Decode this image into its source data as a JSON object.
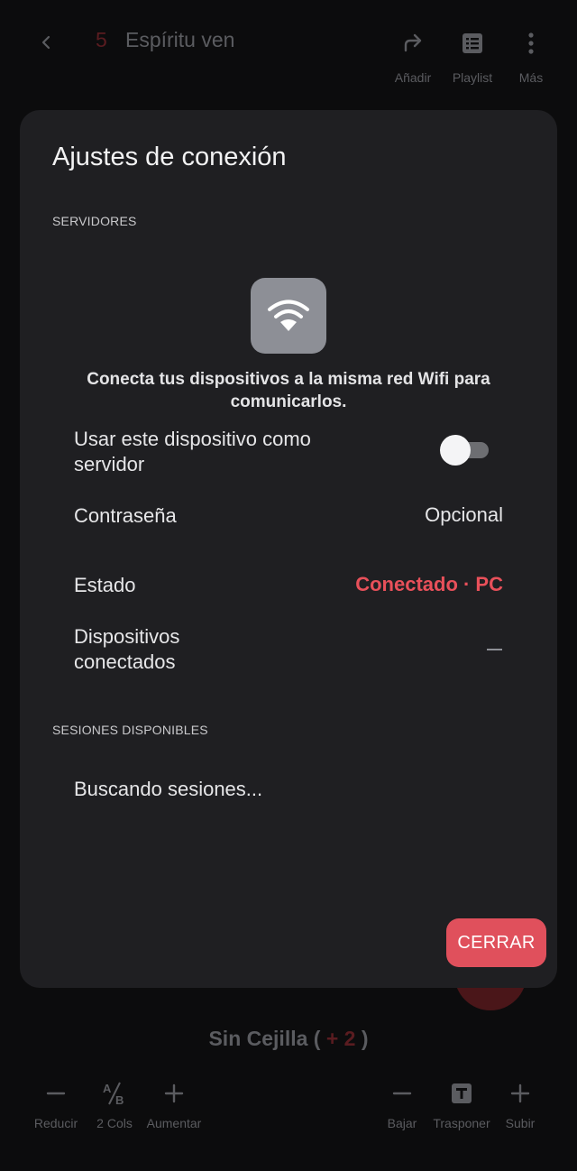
{
  "appbar": {
    "song_number": "5",
    "song_title": "Espíritu ven",
    "actions": [
      {
        "label": "Añadir",
        "icon": "share-arrow-icon"
      },
      {
        "label": "Playlist",
        "icon": "list-icon"
      },
      {
        "label": "Más",
        "icon": "more-vertical-icon"
      }
    ]
  },
  "dialog": {
    "title": "Ajustes de conexión",
    "servers_label": "SERVIDORES",
    "wifi_hint": "Conecta tus dispositivos a la misma red Wifi para comunicarlos.",
    "use_as_server_label": "Usar este dispositivo como servidor",
    "use_as_server_on": false,
    "password_label": "Contraseña",
    "password_value": "Opcional",
    "status_label": "Estado",
    "status_value": "Conectado · PC",
    "devices_label": "Dispositivos conectados",
    "devices_value": "—",
    "sessions_label": "SESIONES DISPONIBLES",
    "sessions_status": "Buscando sesiones...",
    "close_label": "CERRAR"
  },
  "capo": {
    "prefix": "Sin Cejilla (",
    "value": "+ 2",
    "suffix": ")"
  },
  "toolbar": {
    "left": [
      {
        "label": "Reducir",
        "icon": "minus-icon"
      },
      {
        "label": "2 Cols",
        "icon": "columns-ab-icon"
      },
      {
        "label": "Aumentar",
        "icon": "plus-icon"
      }
    ],
    "right": [
      {
        "label": "Bajar",
        "icon": "minus-icon"
      },
      {
        "label": "Trasponer",
        "icon": "transpose-t-icon"
      },
      {
        "label": "Subir",
        "icon": "plus-icon"
      }
    ]
  },
  "colors": {
    "accent": "#e0505c",
    "status": "#e8505a",
    "dialog_bg": "#1f1f22",
    "screen_bg": "#0c0c0d"
  }
}
